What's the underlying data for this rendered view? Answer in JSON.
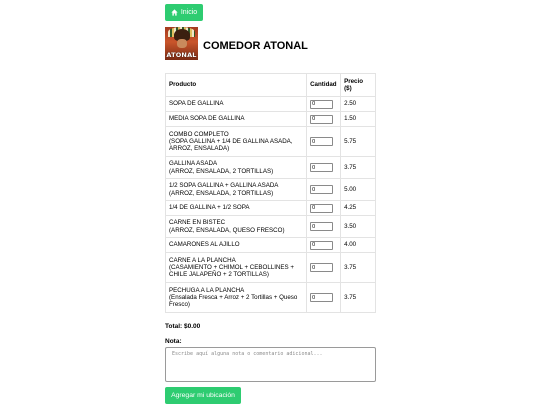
{
  "header": {
    "home_button_label": "Inicio",
    "logo_text": "ATONAL",
    "title": "COMEDOR ATONAL"
  },
  "table": {
    "headers": {
      "product": "Producto",
      "quantity": "Cantidad",
      "price": "Precio ($)"
    },
    "rows": [
      {
        "lines": [
          "SOPA DE GALLINA"
        ],
        "qty": "0",
        "price": "2.50"
      },
      {
        "lines": [
          "MEDIA SOPA DE GALLINA"
        ],
        "qty": "0",
        "price": "1.50"
      },
      {
        "lines": [
          "COMBO COMPLETO",
          "(SOPA GALLINA + 1/4 DE GALLINA ASADA, ARROZ, ENSALADA)"
        ],
        "qty": "0",
        "price": "5.75"
      },
      {
        "lines": [
          "GALLINA ASADA",
          "(ARROZ, ENSALADA, 2 TORTILLAS)"
        ],
        "qty": "0",
        "price": "3.75"
      },
      {
        "lines": [
          "1/2 SOPA GALLINA + GALLINA ASADA",
          "(ARROZ, ENSALADA, 2 TORTILLAS)"
        ],
        "qty": "0",
        "price": "5.00"
      },
      {
        "lines": [
          "1/4 DE GALLINA + 1/2 SOPA"
        ],
        "qty": "0",
        "price": "4.25"
      },
      {
        "lines": [
          "CARNE EN BISTEC",
          "(ARROZ, ENSALADA, QUESO FRESCO)"
        ],
        "qty": "0",
        "price": "3.50"
      },
      {
        "lines": [
          "CAMARONES AL AJILLO"
        ],
        "qty": "0",
        "price": "4.00"
      },
      {
        "lines": [
          "CARNE A LA PLANCHA",
          "(CASAMIENTO + CHIMOL + CEBOLLINES + CHILE JALAPEÑO + 2 TORTILLAS)"
        ],
        "qty": "0",
        "price": "3.75"
      },
      {
        "lines": [
          "PECHUGA A LA PLANCHA",
          "(Ensalada Fresca + Arroz + 2 Tortillas + Queso Fresco)"
        ],
        "qty": "0",
        "price": "3.75"
      }
    ]
  },
  "total_label": "Total: $0.00",
  "note": {
    "label": "Nota:",
    "placeholder": "Escribe aquí alguna nota o comentario adicional..."
  },
  "location_button_label": "Agregar mi ubicación",
  "colors": {
    "accent": "#2ecc71"
  }
}
